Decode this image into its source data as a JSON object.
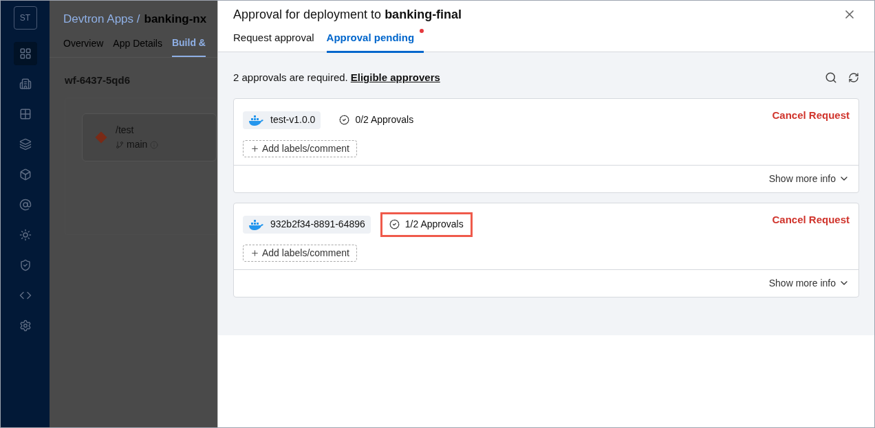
{
  "sidebar": {
    "logo": "ST",
    "items": [
      {
        "selected": true
      },
      {
        "selected": false
      },
      {
        "selected": false
      },
      {
        "selected": false
      },
      {
        "selected": false
      },
      {
        "selected": false
      },
      {
        "selected": false
      },
      {
        "selected": false
      },
      {
        "selected": false
      },
      {
        "selected": false
      }
    ]
  },
  "background": {
    "breadcrumb": "Devtron Apps /",
    "app_name": "banking-nx",
    "tabs": [
      {
        "label": "Overview",
        "selected": false
      },
      {
        "label": "App Details",
        "selected": false
      },
      {
        "label": "Build &",
        "selected": true
      }
    ],
    "workflow": "wf-6437-5qd6",
    "node": {
      "path": "/test",
      "branch": "main"
    }
  },
  "drawer": {
    "title": "Approval for deployment to **banking-final**",
    "tabs": [
      {
        "label": "Request approval",
        "selected": false,
        "dot": false
      },
      {
        "label": "Approval pending",
        "selected": true,
        "dot": true
      }
    ],
    "summary": "2 approvals are required.",
    "link": "Eligible approvers",
    "requests": [
      {
        "image": "test-v1.0.0",
        "approvals": "0/2 Approvals",
        "highlighted": false,
        "add_label": "Add labels/comment",
        "cancel": "Cancel Request",
        "more": "Show more info"
      },
      {
        "image": "932b2f34-8891-64896",
        "approvals": "1/2 Approvals",
        "highlighted": true,
        "add_label": "Add labels/comment",
        "cancel": "Cancel Request",
        "more": "Show more info"
      }
    ]
  }
}
